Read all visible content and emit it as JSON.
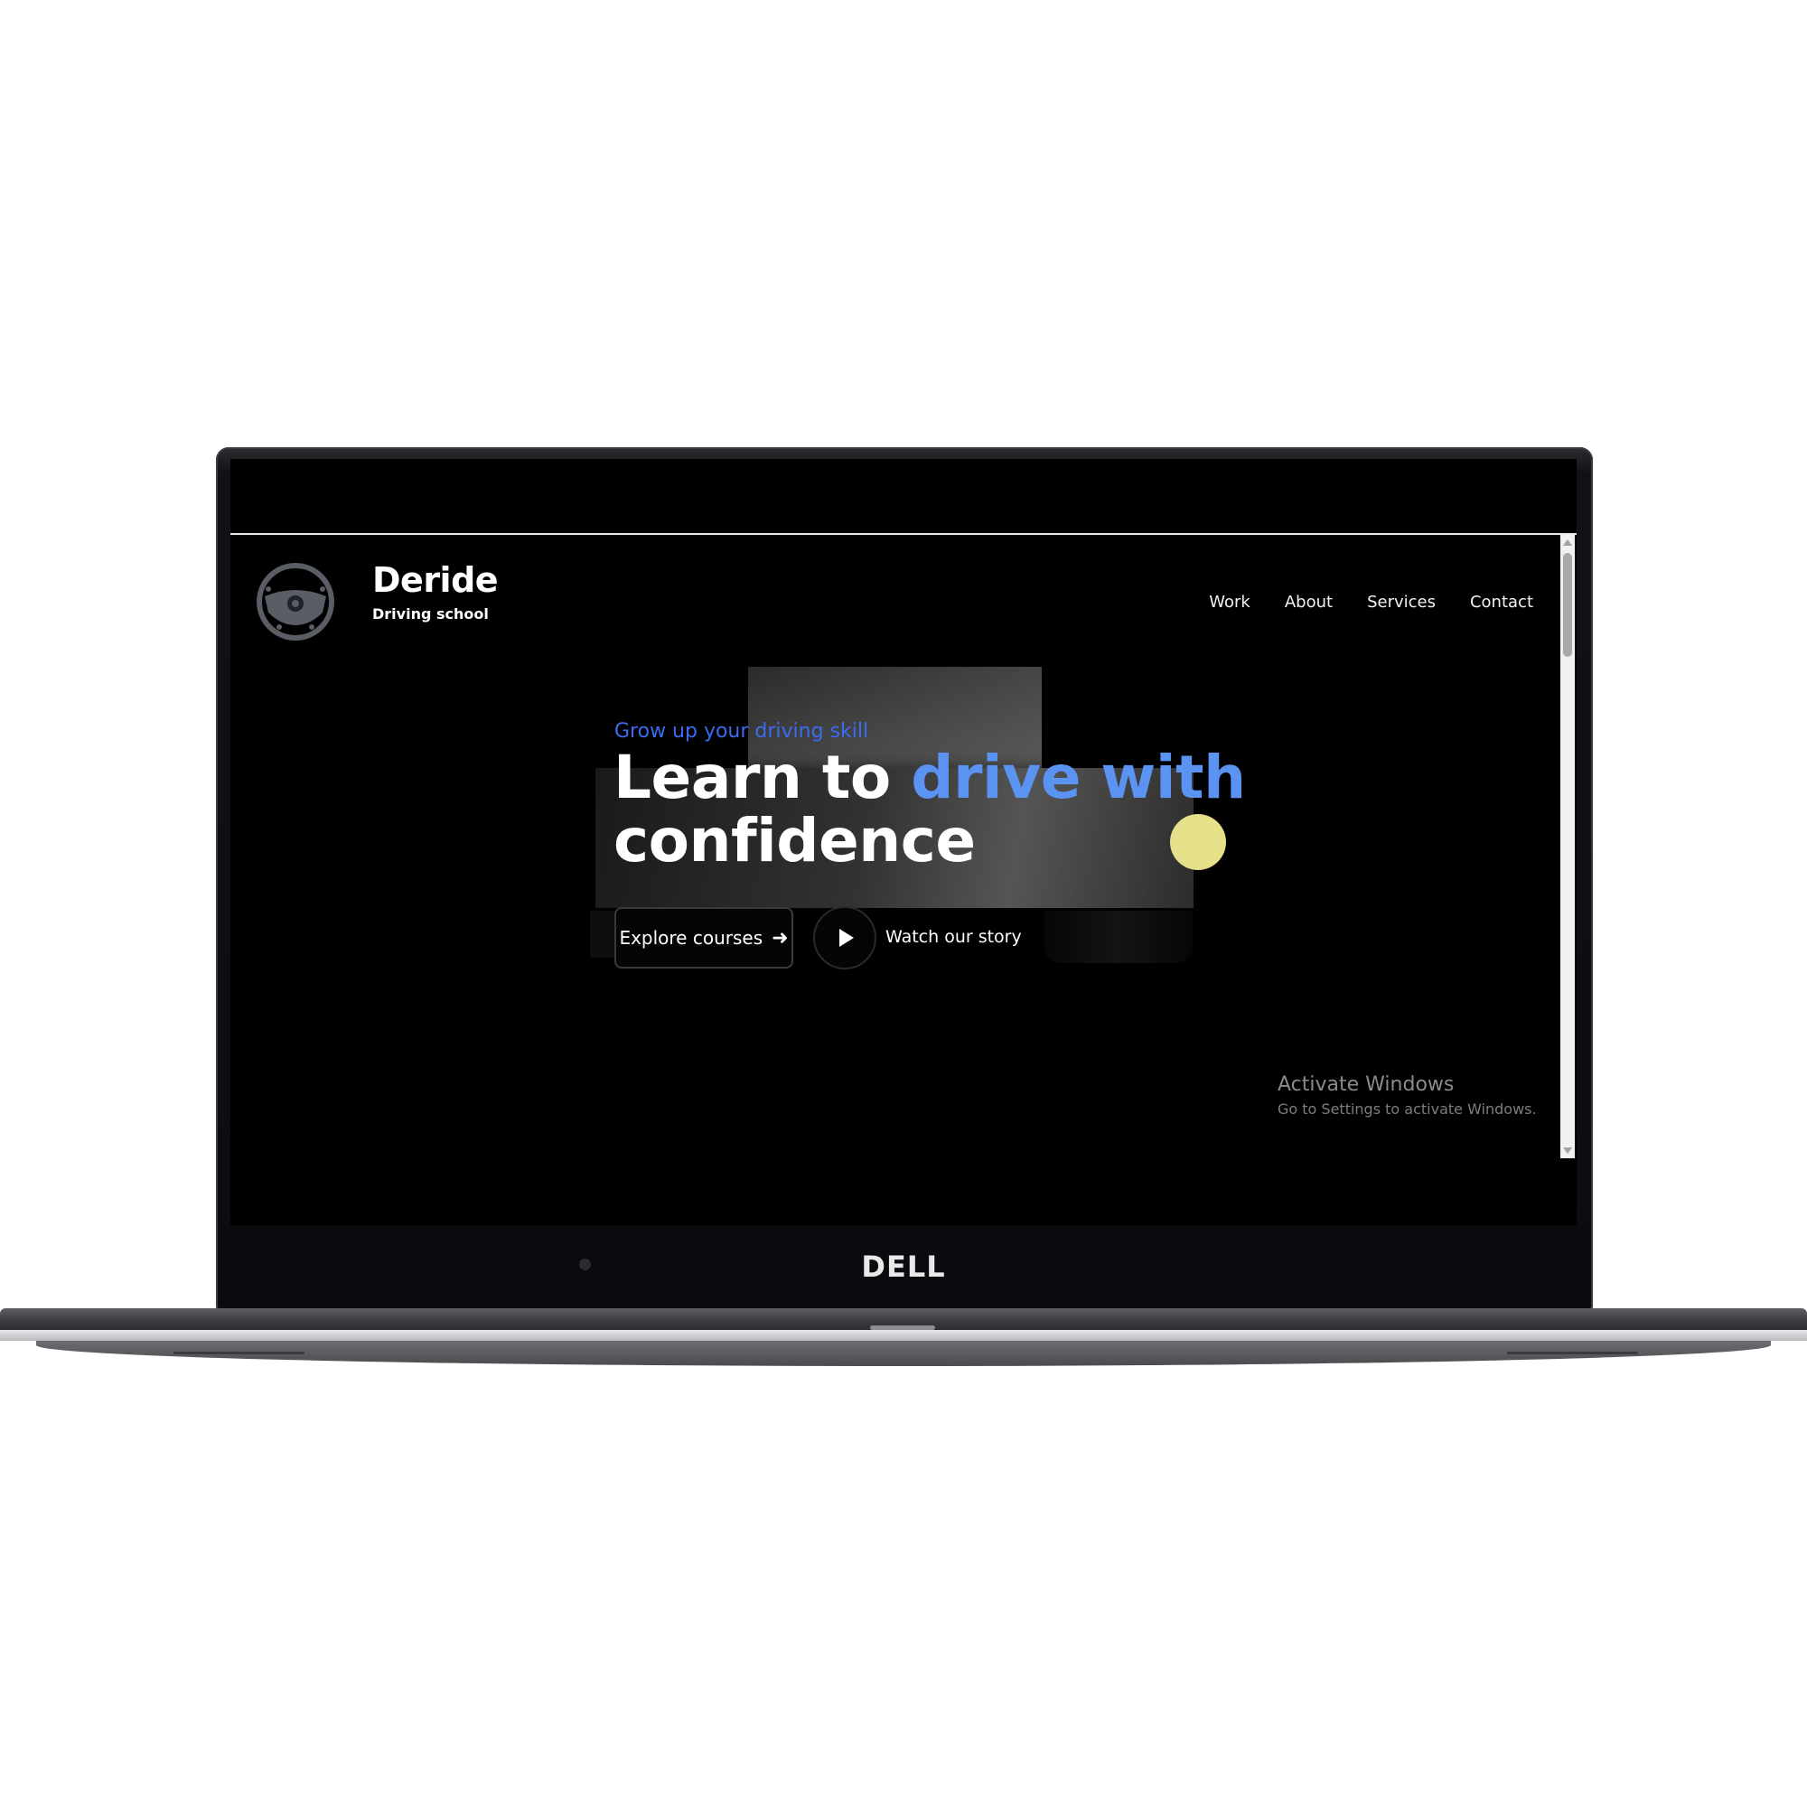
{
  "device": {
    "brand": "DELL"
  },
  "site": {
    "brand_name": "Deride",
    "brand_tagline": "Driving school",
    "logo_icon": "steering-wheel-icon",
    "nav": [
      {
        "label": "Work"
      },
      {
        "label": "About"
      },
      {
        "label": "Services"
      },
      {
        "label": "Contact"
      }
    ],
    "hero": {
      "eyebrow": "Grow up your driving skill",
      "headline_part1": "Learn to ",
      "headline_accent": "drive with",
      "headline_part2": "confidence",
      "cta_primary": "Explore courses",
      "cta_primary_icon": "arrow-right-icon",
      "cta_secondary": "Watch our story",
      "cta_secondary_icon": "play-icon"
    }
  },
  "os_watermark": {
    "title": "Activate Windows",
    "subtitle": "Go to Settings to activate Windows."
  },
  "colors": {
    "background": "#000000",
    "eyebrow": "#3b6cf0",
    "accent": "#5b93f3",
    "yellow": "#e6e08a",
    "text": "#ffffff"
  }
}
